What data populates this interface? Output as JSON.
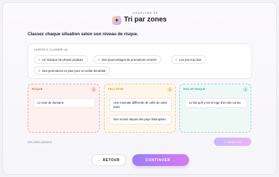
{
  "header": {
    "chapter": "CHAPITRE 05",
    "title": "Tri par zones",
    "logo_icon": "document-sparkle-icon"
  },
  "instruction": "Classez chaque situation selon son niveau de risque.",
  "pool": {
    "label": "CARTES À CLASSER (4)",
    "cards": [
      "Un manque de photos produits",
      "Des pourcentages de promotions erronés",
      "Les prix trop bas",
      "Des promotions en plus pour un achat immédiat"
    ]
  },
  "zones": [
    {
      "label": "RISQUE",
      "count": "1",
      "color": "#e0463c",
      "bg": "#fdf1f0",
      "border": "#f1a8a0",
      "badge_bg": "#f9d1cc",
      "cards": [
        "Le nom de domaine"
      ]
    },
    {
      "label": "PEUT-ÊTRE",
      "count": "2",
      "color": "#d98a14",
      "bg": "#fdf6ea",
      "border": "#eecb8a",
      "badge_bg": "#f6dfb0",
      "cards": [
        "Une monnaie différente de celle de votre pays",
        "Des envois depuis des pays limitrophes"
      ]
    },
    {
      "label": "PAS DE RISQUE",
      "count": "1",
      "color": "#16a089",
      "bg": "#eef9f6",
      "border": "#93dbc9",
      "badge_bg": "#c9eee3",
      "cards": [
        "Le fait qu'il y est le logo d'un site connu"
      ]
    }
  ],
  "progress": "4/8 cartes placées",
  "check_button": "✓ Vérifier le tri",
  "back_button": "← RETOUR",
  "next_button": "CONTINUER →"
}
